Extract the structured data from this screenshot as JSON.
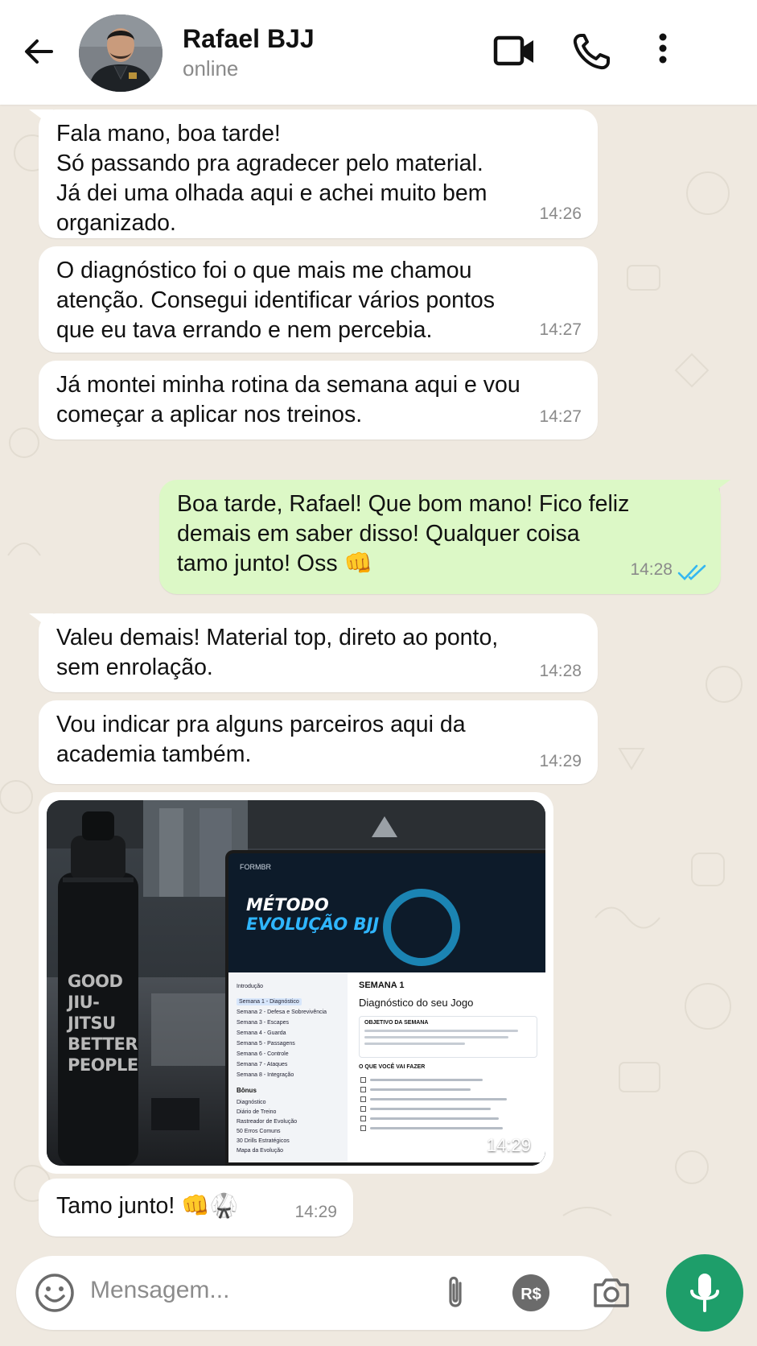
{
  "header": {
    "name": "Rafael BJJ",
    "status": "online",
    "icons": [
      "back-arrow-icon",
      "video-call-icon",
      "phone-icon",
      "more-vert-icon"
    ]
  },
  "messages": [
    {
      "direction": "in",
      "text": "Fala mano, boa tarde!\nSó passando pra agradecer pelo material.\nJá dei uma olhada aqui e achei muito bem\norganizado.",
      "time": "14:26"
    },
    {
      "direction": "in",
      "text": "O diagnóstico foi o que mais me chamou\natenção. Consegui identificar vários pontos\nque eu tava errando e nem percebia.",
      "time": "14:27"
    },
    {
      "direction": "in",
      "text": "Já montei minha rotina da semana aqui e vou\ncomeçar a aplicar nos treinos.",
      "time": "14:27"
    },
    {
      "direction": "out",
      "text": "Boa tarde, Rafael! Que bom mano! Fico feliz\ndemais em saber disso! Qualquer coisa\ntamo junto! Oss 👊",
      "time": "14:28",
      "status": "read"
    },
    {
      "direction": "in",
      "text": "Valeu demais! Material top, direto ao ponto,\nsem enrolação.",
      "time": "14:28"
    },
    {
      "direction": "in",
      "text": "Vou indicar pra alguns parceiros aqui da\nacademia também.",
      "time": "14:29"
    },
    {
      "direction": "in",
      "text": "Tamo junto! 👊🥋",
      "time": "14:29"
    }
  ],
  "image_message": {
    "time": "14:29",
    "bottle_text": "GOOD\nJIU-JITSU\nBETTER\nPEOPLE",
    "screen": {
      "brand": "FORMBR",
      "title_line1": "MÉTODO",
      "title_line2": "EVOLUÇÃO BJJ",
      "nav": [
        "Introdução",
        "Semana 1 - Diagnóstico",
        "Semana 2 - Defesa e Sobrevivência",
        "Semana 3 - Escapes",
        "Semana 4 - Guarda",
        "Semana 5 - Passagens",
        "Semana 6 - Controle",
        "Semana 7 - Ataques",
        "Semana 8 - Integração"
      ],
      "bonus_heading": "Bônus",
      "bonus": [
        "Diagnóstico",
        "Diário de Treino",
        "Rastreador de Evolução",
        "50 Erros Comuns",
        "30 Drills Estratégicos",
        "Mapa da Evolução"
      ],
      "week_label": "SEMANA 1",
      "week_title": "Diagnóstico do seu Jogo",
      "objective_heading": "OBJETIVO DA SEMANA",
      "todo_heading": "O QUE VOCÊ VAI FAZER"
    }
  },
  "input": {
    "placeholder": "Mensagem...",
    "payment_label": "R$"
  },
  "colors": {
    "incoming": "#ffffff",
    "outgoing": "#dcf8c6",
    "read_ticks": "#34b7f1",
    "mic": "#1e9e6a"
  }
}
